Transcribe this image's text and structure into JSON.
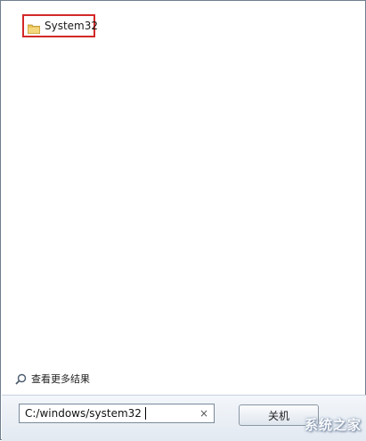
{
  "results": {
    "folder": {
      "label": "System32",
      "icon": "folder-icon"
    }
  },
  "see_more": {
    "label": "查看更多结果",
    "icon": "search-icon"
  },
  "search": {
    "value": "C:/windows/system32",
    "clear_symbol": "×"
  },
  "action_button": {
    "label": "关机"
  },
  "watermark": {
    "label": "系统之家"
  },
  "colors": {
    "highlight": "#d32828",
    "bar": "#e2e9f1"
  }
}
